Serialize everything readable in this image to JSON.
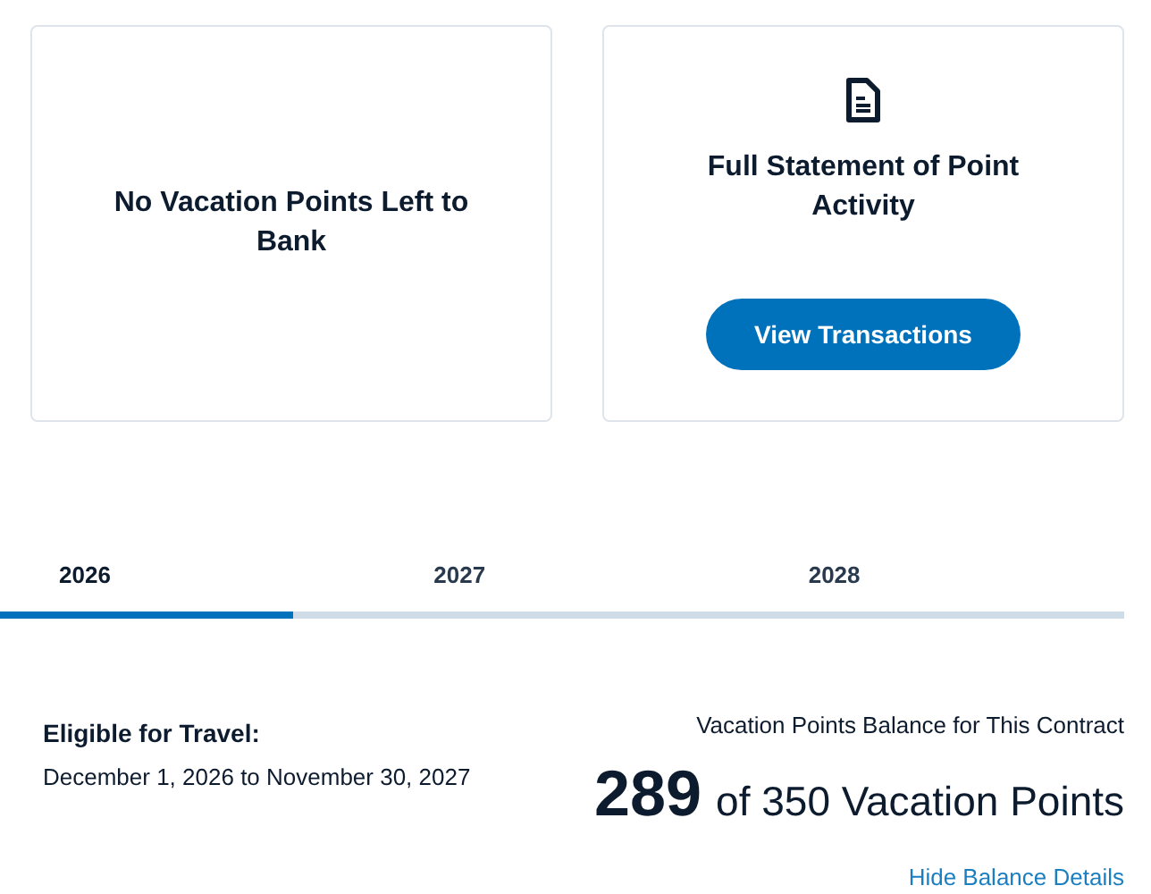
{
  "cards": [
    {
      "kind": "text",
      "title": "No Vacation Points Left to Bank"
    },
    {
      "kind": "action",
      "title": "Full Statement of Point Activity",
      "button": "View Transactions"
    }
  ],
  "tabs": [
    {
      "label": "2026",
      "selected": true
    },
    {
      "label": "2027",
      "selected": false
    },
    {
      "label": "2028",
      "selected": false
    }
  ],
  "eligibility": {
    "heading": "Eligible for Travel:",
    "dates": "December 1, 2026 to November 30, 2027"
  },
  "balance": {
    "label": "Vacation Points Balance for This Contract",
    "used": "289",
    "total": "of 350 Vacation Points",
    "link": "Hide Balance Details"
  }
}
